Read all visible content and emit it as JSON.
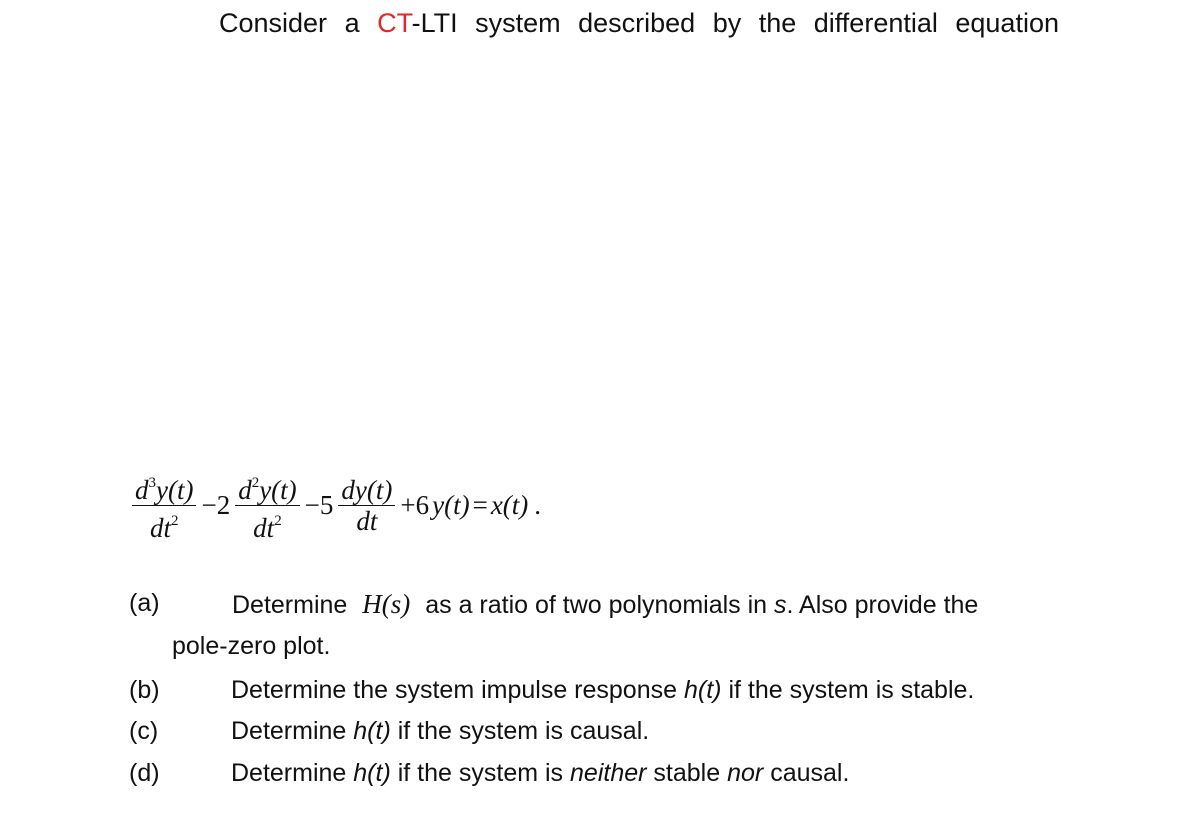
{
  "intro": {
    "words": [
      "Consider",
      "a"
    ],
    "ct": "CT",
    "lti": "-LTI",
    "rest": [
      "system",
      "described",
      "by",
      "the",
      "differential",
      "equation"
    ],
    "accent_color": "#e0262a"
  },
  "equation": {
    "term1": {
      "num_d": "d",
      "num_pow": "3",
      "num_y": "y(t)",
      "den": "dt",
      "den_pow": "2"
    },
    "op1": "−2",
    "term2": {
      "num_d": "d",
      "num_pow": "2",
      "num_y": "y(t)",
      "den": "dt",
      "den_pow": "2"
    },
    "op2": "−5",
    "term3": {
      "num": "dy(t)",
      "den": "dt"
    },
    "tail_plus": "+6",
    "tail_y": "y(t)",
    "equals": "=",
    "rhs": "x(t)",
    "period": "."
  },
  "parts": [
    {
      "label": "(a)",
      "pre": "Determine",
      "math": "H(s)",
      "post": "as a ratio of two polynomials in",
      "var": "s",
      "post2": ". Also provide the",
      "cont": "pole-zero plot."
    },
    {
      "label": "(b)",
      "pre": "Determine the system impulse response",
      "h": "h(t)",
      "post": "if the system is stable."
    },
    {
      "label": "(c)",
      "pre": "Determine",
      "h": "h(t)",
      "post": "if the system is causal."
    },
    {
      "label": "(d)",
      "pre": "Determine",
      "h": "h(t)",
      "mid": "if the system is",
      "neither": "neither",
      "stable": "stable",
      "nor": "nor",
      "end": "causal."
    }
  ]
}
